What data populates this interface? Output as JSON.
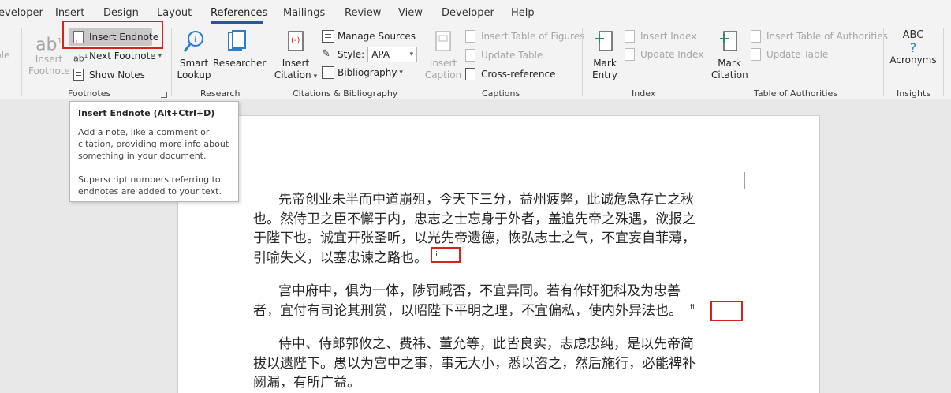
{
  "tabs": [
    "eveloper",
    "Insert",
    "Design",
    "Layout",
    "References",
    "Mailings",
    "Review",
    "View",
    "Developer",
    "Help"
  ],
  "active_tab": "References",
  "ribbon": {
    "left_partial": {
      "top": "ble",
      "bottom": "ble"
    },
    "footnotes": {
      "insert_footnote": [
        "Insert",
        "Footnote"
      ],
      "insert_endnote": "Insert Endnote",
      "next_footnote": "Next Footnote",
      "show_notes": "Show Notes",
      "group": "Footnotes"
    },
    "research": {
      "smart_lookup": [
        "Smart",
        "Lookup"
      ],
      "researcher": "Researcher",
      "group": "Research"
    },
    "citations": {
      "insert_citation": [
        "Insert",
        "Citation"
      ],
      "manage_sources": "Manage Sources",
      "style_label": "Style:",
      "style_value": "APA",
      "bibliography": "Bibliography",
      "group": "Citations & Bibliography"
    },
    "captions": {
      "insert_caption": [
        "Insert",
        "Caption"
      ],
      "insert_table_of_figures": "Insert Table of Figures",
      "update_table": "Update Table",
      "cross_reference": "Cross-reference",
      "group": "Captions"
    },
    "index": {
      "mark_entry": [
        "Mark",
        "Entry"
      ],
      "insert_index": "Insert Index",
      "update_index": "Update Index",
      "group": "Index"
    },
    "toa": {
      "mark_citation": [
        "Mark",
        "Citation"
      ],
      "insert_table_of_authorities": "Insert Table of Authorities",
      "update_table": "Update Table",
      "group": "Table of Authorities"
    },
    "insights": {
      "abc": "ABC",
      "question": "?",
      "acronyms": "Acronyms",
      "group": "Insights"
    }
  },
  "tooltip": {
    "title": "Insert Endnote (Alt+Ctrl+D)",
    "body1": "Add a note, like a comment or citation, providing more info about something in your document.",
    "body2": "Superscript numbers referring to endnotes are added to your text."
  },
  "document": {
    "paragraphs": [
      {
        "lines": [
          "先帝创业未半而中道崩殂，今天下三分，益州疲弊，此诚危急存亡之秋",
          "也。然侍卫之臣不懈于内，忠志之士忘身于外者，盖追先帝之殊遇，欲报之",
          "于陛下也。诚宜开张圣听，以光先帝遗德，恢弘志士之气，不宜妄自菲薄，",
          "引喻失义，以塞忠谏之路也。"
        ],
        "note": "i"
      },
      {
        "lines": [
          "宫中府中，俱为一体，陟罚臧否，不宜异同。若有作奸犯科及为忠善",
          "者，宜付有司论其刑赏，以昭陛下平明之理，不宜偏私，使内外异法也。"
        ],
        "note": "ii"
      },
      {
        "lines": [
          "侍中、侍郎郭攸之、费祎、董允等，此皆良实，志虑忠纯，是以先帝简",
          "拔以遗陛下。愚以为宫中之事，事无大小，悉以咨之，然后施行，必能裨补",
          "阙漏，有所广益。"
        ],
        "note": ""
      }
    ]
  },
  "colors": {
    "accent": "#2b579a",
    "highlight_red": "#d9211d"
  }
}
